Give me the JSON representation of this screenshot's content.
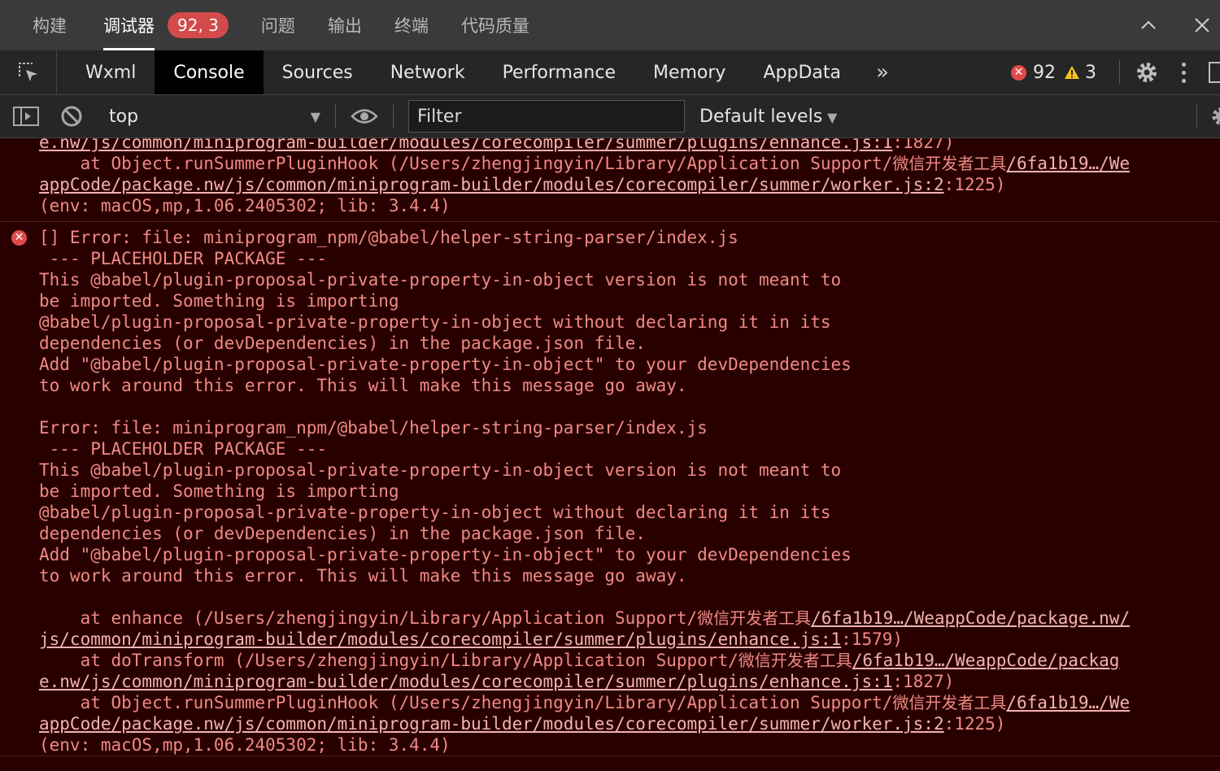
{
  "top_tabs": [
    "构建",
    "调试器",
    "问题",
    "输出",
    "终端",
    "代码质量"
  ],
  "debugger_badge": "92, 3",
  "devtools_tabs": [
    "Wxml",
    "Console",
    "Sources",
    "Network",
    "Performance",
    "Memory",
    "AppData"
  ],
  "more_tabs": "»",
  "error_count": "92",
  "warning_count": "3",
  "context_select": "top",
  "filter_placeholder": "Filter",
  "levels_label": "Default levels",
  "colors": {
    "error_bg": "#290000",
    "error_text": "#f08a84",
    "error_icon": "#e24a4a",
    "warning": "#f5c518"
  },
  "console": {
    "prev_tail": [
      {
        "link": "e.nw/js/common/miniprogram-builder/modules/corecompiler/summer/plugins/enhance.js:1",
        "after": ":1827)"
      },
      {
        "text": "    at Object.runSummerPluginHook (/Users/zhengjingyin/Library/Application Support/",
        "cn": "微信开发者工具",
        "link": "/6fa1b19…/We"
      },
      {
        "link": "appCode/package.nw/js/common/miniprogram-builder/modules/corecompiler/summer/worker.js:2",
        "after": ":1225)"
      },
      {
        "text": "(env: macOS,mp,1.06.2405302; lib: 3.4.4)"
      }
    ],
    "error_lines": [
      "[] Error: file: miniprogram_npm/@babel/helper-string-parser/index.js",
      " --- PLACEHOLDER PACKAGE ---",
      "This @babel/plugin-proposal-private-property-in-object version is not meant to",
      "be imported. Something is importing",
      "@babel/plugin-proposal-private-property-in-object without declaring it in its",
      "dependencies (or devDependencies) in the package.json file.",
      "Add \"@babel/plugin-proposal-private-property-in-object\" to your devDependencies",
      "to work around this error. This will make this message go away.",
      "",
      "Error: file: miniprogram_npm/@babel/helper-string-parser/index.js",
      " --- PLACEHOLDER PACKAGE ---",
      "This @babel/plugin-proposal-private-property-in-object version is not meant to",
      "be imported. Something is importing",
      "@babel/plugin-proposal-private-property-in-object without declaring it in its",
      "dependencies (or devDependencies) in the package.json file.",
      "Add \"@babel/plugin-proposal-private-property-in-object\" to your devDependencies",
      "to work around this error. This will make this message go away.",
      ""
    ],
    "stack": [
      {
        "text": "    at enhance (/Users/zhengjingyin/Library/Application Support/",
        "cn": "微信开发者工具",
        "link": "/6fa1b19…/WeappCode/package.nw/"
      },
      {
        "link": "js/common/miniprogram-builder/modules/corecompiler/summer/plugins/enhance.js:1",
        "after": ":1579)"
      },
      {
        "text": "    at doTransform (/Users/zhengjingyin/Library/Application Support/",
        "cn": "微信开发者工具",
        "link": "/6fa1b19…/WeappCode/packag"
      },
      {
        "link": "e.nw/js/common/miniprogram-builder/modules/corecompiler/summer/plugins/enhance.js:1",
        "after": ":1827)"
      },
      {
        "text": "    at Object.runSummerPluginHook (/Users/zhengjingyin/Library/Application Support/",
        "cn": "微信开发者工具",
        "link": "/6fa1b19…/We"
      },
      {
        "link": "appCode/package.nw/js/common/miniprogram-builder/modules/corecompiler/summer/worker.js:2",
        "after": ":1225)"
      },
      {
        "text": "(env: macOS,mp,1.06.2405302; lib: 3.4.4)"
      }
    ]
  }
}
